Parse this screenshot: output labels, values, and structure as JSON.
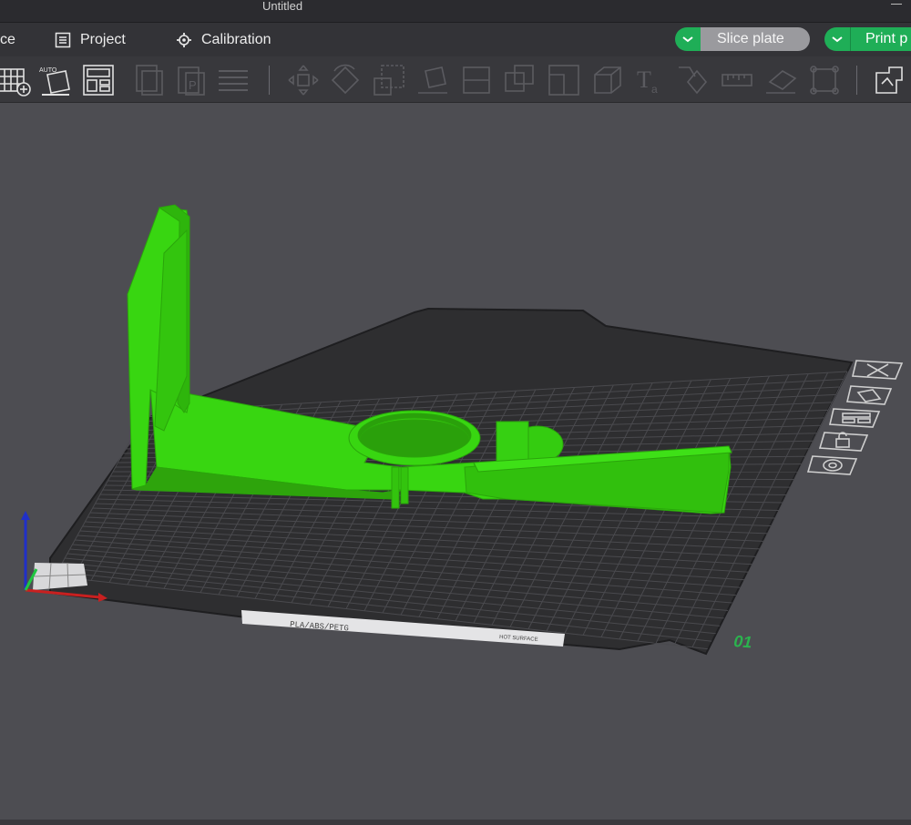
{
  "window": {
    "title": "Untitled"
  },
  "menu": {
    "prepare_partial": "ce",
    "project": "Project",
    "calibration": "Calibration"
  },
  "actions": {
    "slice_plate": "Slice plate",
    "print_plate": "Print p"
  },
  "plate": {
    "label_left": "PLA/ABS/PETG",
    "label_right": "HOT SURFACE",
    "number": "01"
  },
  "colors": {
    "accent": "#1fae57",
    "model": "#38d611",
    "background": "#4d4d52",
    "bed": "#2e2e30"
  },
  "toolbar_icons": [
    "add-plate-icon",
    "auto-orient-icon",
    "arrange-icon",
    "copy-icon",
    "paste-icon",
    "layers-icon",
    "move-icon",
    "rotate-icon",
    "scale-icon",
    "lay-on-face-icon",
    "cut-icon",
    "boolean-icon",
    "split-parts-icon",
    "assembly-icon",
    "text-icon",
    "paint-support-icon",
    "measure-icon",
    "seam-icon",
    "fit-view-icon",
    "variable-layer-icon"
  ]
}
